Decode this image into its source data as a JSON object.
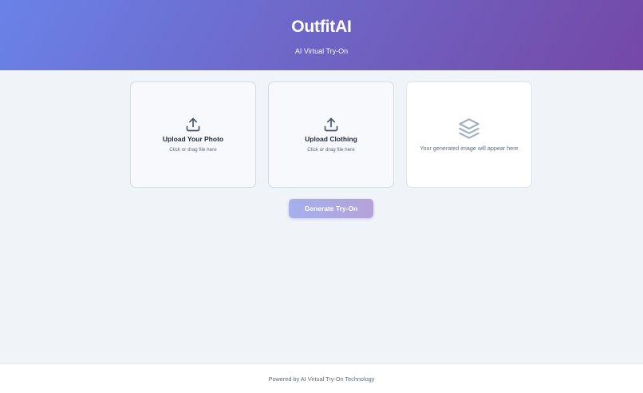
{
  "header": {
    "brand": "OutfitAI",
    "tagline": "AI Virtual Try-On"
  },
  "cards": {
    "photo": {
      "title": "Upload Your Photo",
      "hint": "Click or drag file here",
      "icon": "upload-icon"
    },
    "clothing": {
      "title": "Upload Clothing",
      "hint": "Click or drag file here",
      "icon": "upload-icon"
    },
    "result": {
      "placeholder": "Your generated image will appear here",
      "icon": "layers-icon"
    }
  },
  "actions": {
    "generate_label": "Generate Try-On",
    "generate_enabled": false
  },
  "footer": {
    "text": "Powered by AI Virtual Try-On Technology"
  },
  "colors": {
    "header_gradient_start": "#6a82e8",
    "header_gradient_end": "#7548a6",
    "background": "#f0f3f8",
    "button_disabled": "#aeaae4"
  }
}
